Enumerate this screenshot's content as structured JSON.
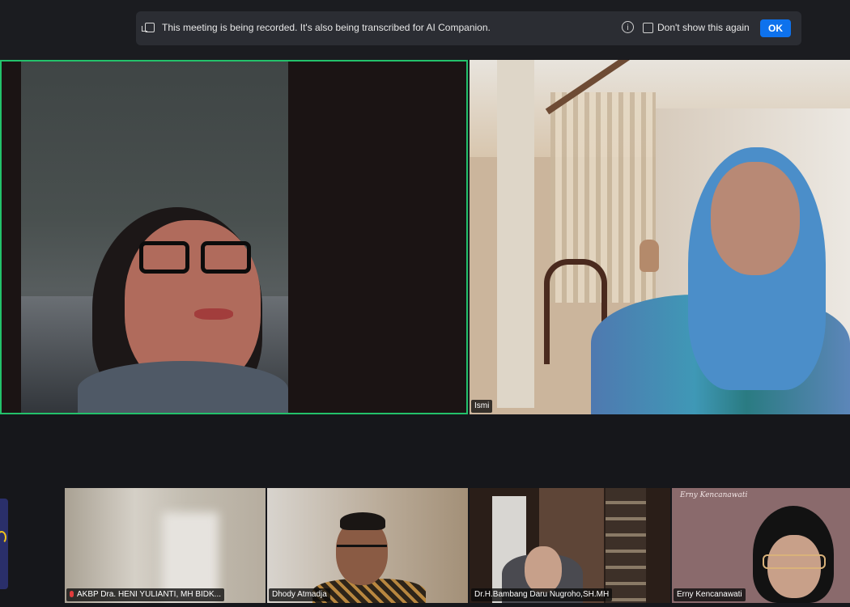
{
  "banner": {
    "message": "This meeting is being recorded. It's also being transcribed for AI Companion.",
    "info_icon": "i",
    "dont_show_label": "Don't show this again",
    "ok_label": "OK"
  },
  "participants": {
    "speaker": {
      "name": ""
    },
    "ismi": {
      "name": "Ismi"
    },
    "thumb1": {
      "name": "AKBP Dra. HENI YULIANTI, MH BIDK..."
    },
    "thumb2": {
      "name": "Dhody Atmadja"
    },
    "thumb3": {
      "name": "Dr.H.Bambang Daru Nugroho,SH.MH"
    },
    "thumb4": {
      "name": "Erny Kencanawati",
      "slide_text": "Erny Kencanawati"
    }
  },
  "colors": {
    "active_speaker_border": "#23c16b",
    "ok_button": "#0e72ed",
    "background": "#16171b"
  }
}
